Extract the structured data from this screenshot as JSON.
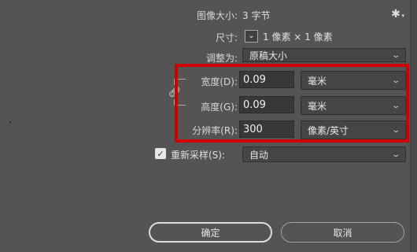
{
  "image_size": {
    "label": "图像大小:",
    "value": "3 字节"
  },
  "dimensions": {
    "label": "尺寸:",
    "value": "1 像素  ×  1 像素"
  },
  "fit_to": {
    "label": "调整为:",
    "value": "原稿大小"
  },
  "width": {
    "label": "宽度(D):",
    "value": "0.09",
    "unit": "毫米"
  },
  "height": {
    "label": "高度(G):",
    "value": "0.09",
    "unit": "毫米"
  },
  "resolution": {
    "label": "分辨率(R):",
    "value": "300",
    "unit": "像素/英寸"
  },
  "resample": {
    "label": "重新采样(S):",
    "checked": true,
    "value": "自动"
  },
  "buttons": {
    "ok": "确定",
    "cancel": "取消"
  },
  "icons": {
    "settings": "gear-icon",
    "dimensions_toggle": "chevron-down-icon",
    "constrain": "link-icon",
    "checkbox": "checkmark-icon"
  },
  "colors": {
    "highlight": "#d10000",
    "background": "#545454"
  }
}
